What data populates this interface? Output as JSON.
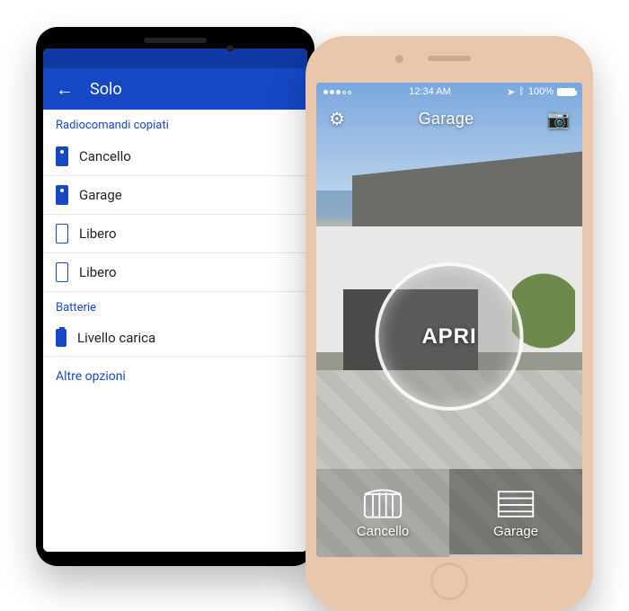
{
  "left": {
    "appbar_title": "Solo",
    "sections": {
      "radio_title": "Radiocomandi copiati",
      "batt_title": "Batterie"
    },
    "rows": {
      "cancello": "Cancello",
      "garage": "Garage",
      "libero1": "Libero",
      "libero2": "Libero",
      "livello": "Livello carica"
    },
    "more": "Altre opzioni"
  },
  "right": {
    "status": {
      "time": "12:34 AM",
      "battery": "100%"
    },
    "header": {
      "title": "Garage"
    },
    "action_label": "APRI",
    "tabs": {
      "cancello": "Cancello",
      "garage": "Garage"
    }
  }
}
